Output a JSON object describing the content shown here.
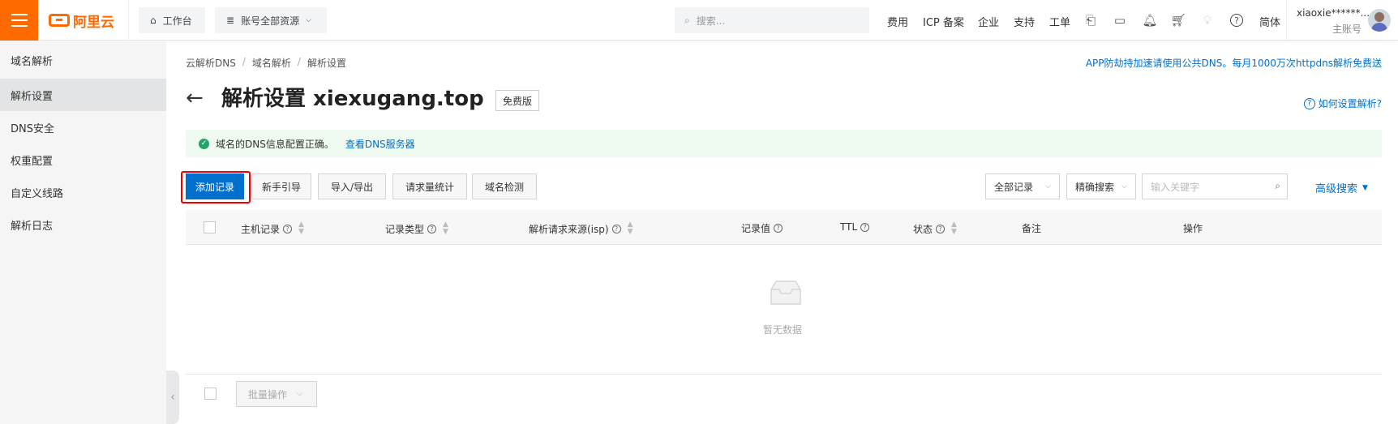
{
  "topbar": {
    "logo_text": "阿里云",
    "workbench": "工作台",
    "resources": "账号全部资源",
    "search_placeholder": "搜索...",
    "nav": [
      "费用",
      "ICP 备案",
      "企业",
      "支持",
      "工单"
    ],
    "lang": "简体",
    "username": "xiaoxie******...",
    "role": "主账号"
  },
  "sidebar": {
    "items": [
      {
        "label": "域名解析"
      },
      {
        "label": "解析设置"
      },
      {
        "label": "DNS安全"
      },
      {
        "label": "权重配置"
      },
      {
        "label": "自定义线路"
      },
      {
        "label": "解析日志"
      }
    ],
    "active_index": 1
  },
  "main": {
    "breadcrumb": [
      "云解析DNS",
      "域名解析",
      "解析设置"
    ],
    "promo": "APP防劫持加速请使用公共DNS。每月1000万次httpdns解析免费送",
    "title": "解析设置 xiexugang.top",
    "badge": "免费版",
    "help": "如何设置解析?",
    "notice_text": "域名的DNS信息配置正确。",
    "notice_link": "查看DNS服务器",
    "buttons": {
      "add": "添加记录",
      "guide": "新手引导",
      "import_export": "导入/导出",
      "stats": "请求量统计",
      "check": "域名检测"
    },
    "filter_all": "全部记录",
    "filter_exact": "精确搜索",
    "keyword_placeholder": "输入关键字",
    "advanced_search": "高级搜索",
    "columns": [
      "主机记录",
      "记录类型",
      "解析请求来源(isp)",
      "记录值",
      "TTL",
      "状态",
      "备注",
      "操作"
    ],
    "empty": "暂无数据",
    "batch": "批量操作"
  },
  "colors": {
    "brand": "#ff6a00",
    "primary": "#0070cc",
    "success": "#23a36a",
    "highlight": "#e00000"
  }
}
